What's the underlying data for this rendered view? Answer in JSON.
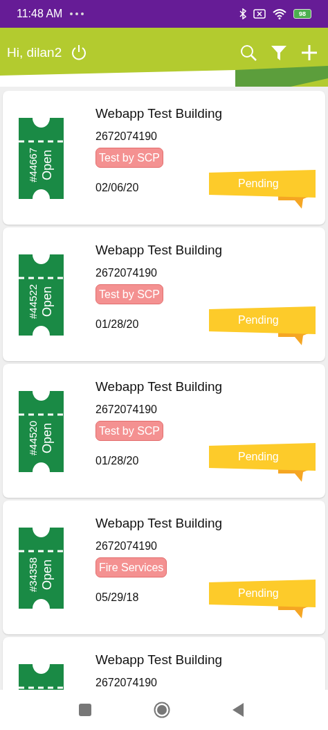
{
  "status_bar": {
    "time": "11:48 AM",
    "battery": "98"
  },
  "header": {
    "greeting": "Hi, dilan2"
  },
  "tickets": [
    {
      "number": "#44667",
      "state": "Open",
      "title": "Webapp Test Building",
      "phone": "2672074190",
      "tag": "Test by SCP",
      "date": "02/06/20",
      "status": "Pending"
    },
    {
      "number": "#44522",
      "state": "Open",
      "title": "Webapp Test Building",
      "phone": "2672074190",
      "tag": "Test by SCP",
      "date": "01/28/20",
      "status": "Pending"
    },
    {
      "number": "#44520",
      "state": "Open",
      "title": "Webapp Test Building",
      "phone": "2672074190",
      "tag": "Test by SCP",
      "date": "01/28/20",
      "status": "Pending"
    },
    {
      "number": "#34358",
      "state": "Open",
      "title": "Webapp Test Building",
      "phone": "2672074190",
      "tag": "Fire Services",
      "date": "05/29/18",
      "status": "Pending"
    },
    {
      "title": "Webapp Test Building",
      "phone": "2672074190"
    }
  ]
}
